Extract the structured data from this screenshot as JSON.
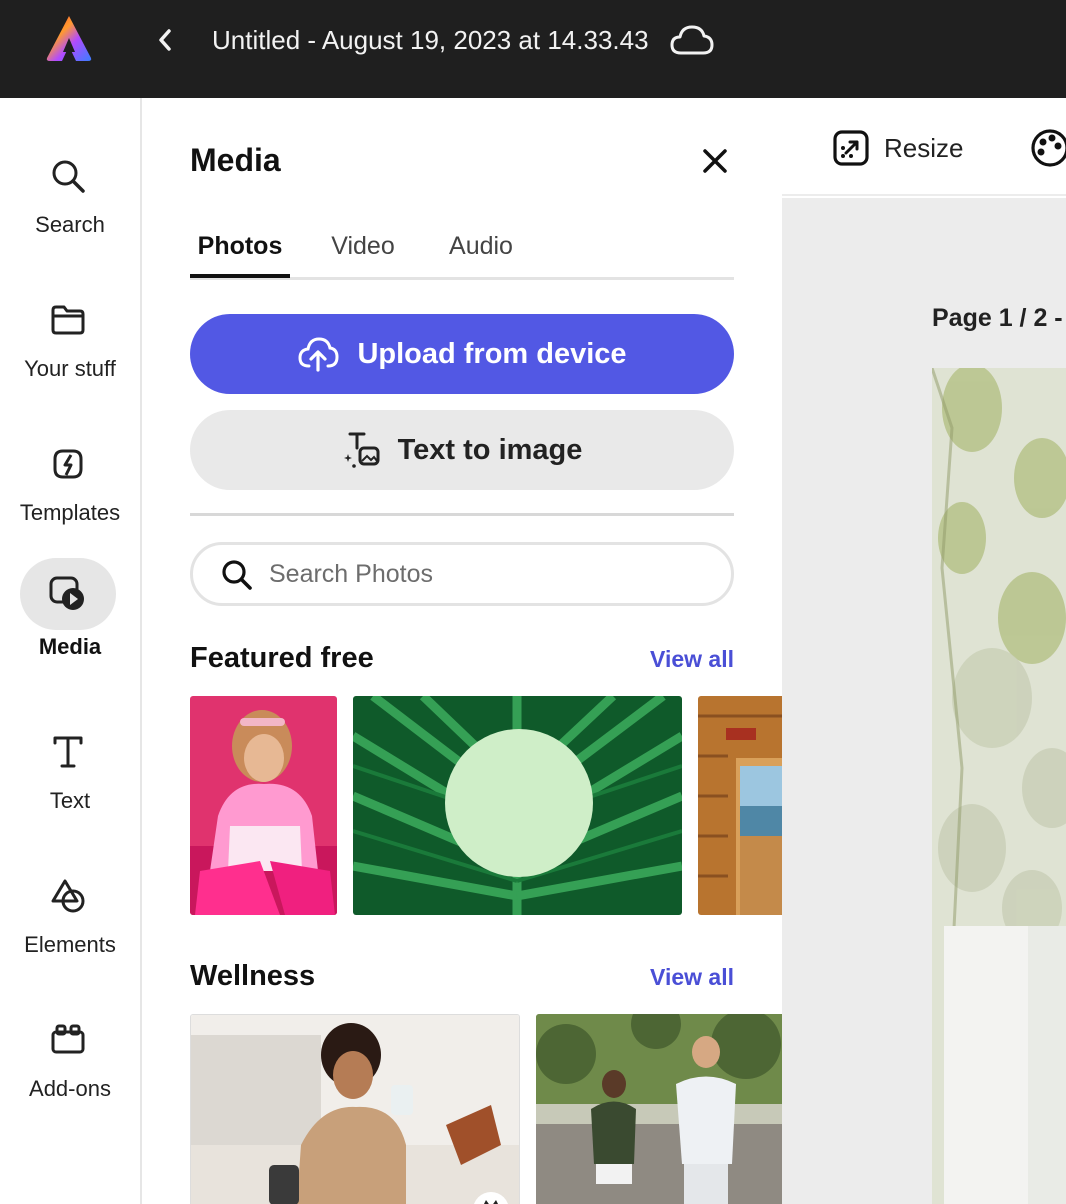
{
  "topbar": {
    "title": "Untitled - August 19, 2023 at 14.33.43"
  },
  "rail": {
    "items": [
      {
        "label": "Search",
        "icon": "search-icon"
      },
      {
        "label": "Your stuff",
        "icon": "folder-icon"
      },
      {
        "label": "Templates",
        "icon": "templates-icon"
      },
      {
        "label": "Media",
        "icon": "media-icon",
        "active": true
      },
      {
        "label": "Text",
        "icon": "text-icon"
      },
      {
        "label": "Elements",
        "icon": "shapes-icon"
      },
      {
        "label": "Add-ons",
        "icon": "addons-icon"
      }
    ]
  },
  "panel": {
    "title": "Media",
    "tabs": [
      {
        "label": "Photos",
        "active": true
      },
      {
        "label": "Video"
      },
      {
        "label": "Audio"
      }
    ],
    "upload_label": "Upload from device",
    "text_to_image_label": "Text to image",
    "search": {
      "placeholder": "Search Photos",
      "value": ""
    },
    "sections": [
      {
        "title": "Featured free",
        "view_all": "View all"
      },
      {
        "title": "Wellness",
        "view_all": "View all"
      }
    ]
  },
  "toolbar": {
    "resize_label": "Resize"
  },
  "canvas": {
    "page_label": "Page 1 / 2 - "
  },
  "colors": {
    "accent": "#5258e4",
    "link": "#4a4fd6",
    "topbar_bg": "#1f1f1f"
  }
}
